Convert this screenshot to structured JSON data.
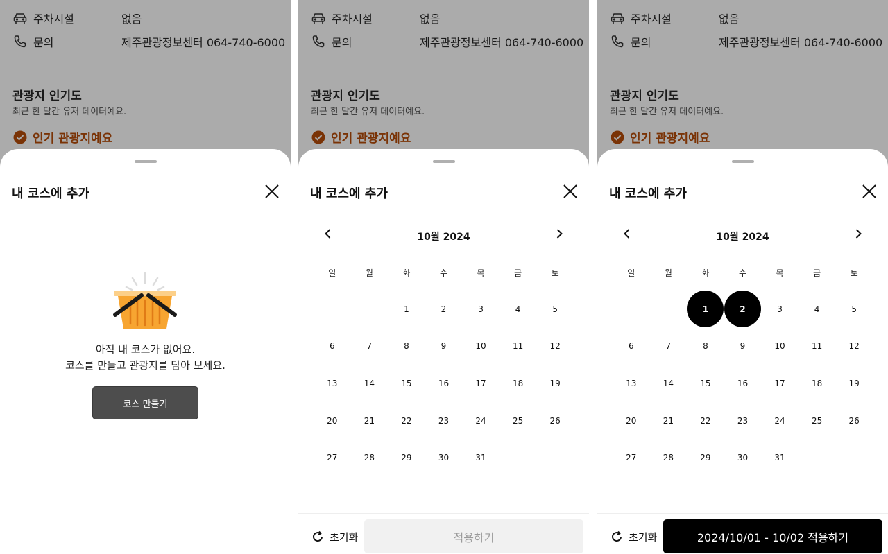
{
  "background_info": {
    "parking_label": "주차시설",
    "parking_value": "없음",
    "contact_label": "문의",
    "contact_value": "제주관광정보센터 064-740-6000",
    "popularity_title": "관광지 인기도",
    "popularity_subtitle": "최근 한 달간 유저 데이터예요.",
    "popular_badge": "인기 관광지예요",
    "badge_color": "#a04000"
  },
  "sheet": {
    "title": "내 코스에 추가"
  },
  "empty_state": {
    "line1": "아직 내 코스가 없어요.",
    "line2": "코스를 만들고 관광지를 담아 보세요.",
    "create_button": "코스 만들기"
  },
  "calendar": {
    "month_label": "10월 2024",
    "weekdays": [
      "일",
      "월",
      "화",
      "수",
      "목",
      "금",
      "토"
    ],
    "first_weekday_index": 2,
    "days_in_month": 31,
    "selected_days_panel3": [
      1,
      2
    ]
  },
  "footer": {
    "reset_label": "초기화",
    "apply_label": "적용하기",
    "apply_label_with_range": "2024/10/01 - 10/02 적용하기"
  },
  "icons": {
    "parking": "car-icon",
    "contact": "phone-icon",
    "badge": "check-circle-icon",
    "close": "close-icon",
    "prev": "chevron-left-icon",
    "next": "chevron-right-icon",
    "reset": "refresh-icon",
    "empty": "basket-icon"
  },
  "colors": {
    "overlay_bg": "#ababab",
    "basket_orange": "#f7a531",
    "selected_day": "#000000",
    "disabled_button": "#f1f1f1",
    "create_button": "#4d4d4d"
  }
}
